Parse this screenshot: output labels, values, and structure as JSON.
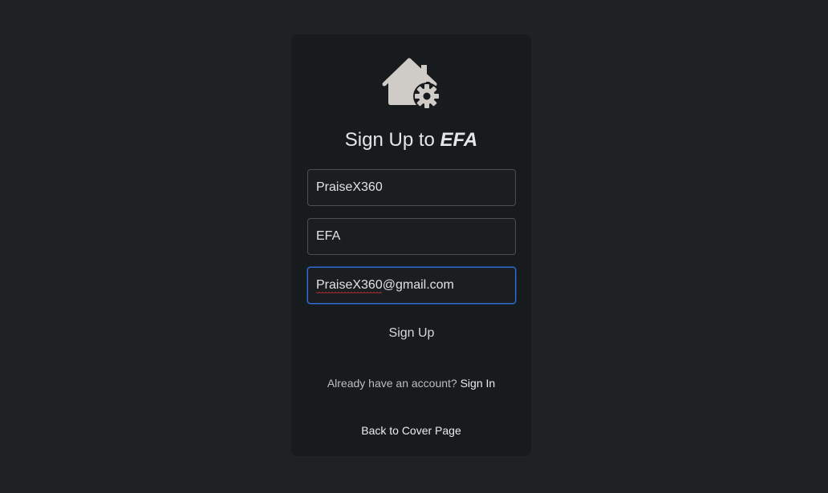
{
  "logo": {
    "icon": "house-gear-icon",
    "color": "#cfcbc6"
  },
  "heading": {
    "prefix": "Sign Up to ",
    "brand": "EFA"
  },
  "form": {
    "username_value": "PraiseX360",
    "name_value": "EFA",
    "email_value": "PraiseX360@gmail.com",
    "submit_label": "Sign Up"
  },
  "footer": {
    "account_prompt": "Already have an account?",
    "sign_in_label": "Sign In",
    "back_label": "Back to Cover Page"
  },
  "colors": {
    "background": "#1e2224",
    "card": "#181b1d",
    "focus_border": "#2f6fd8",
    "spellcheck": "#dd3333"
  }
}
